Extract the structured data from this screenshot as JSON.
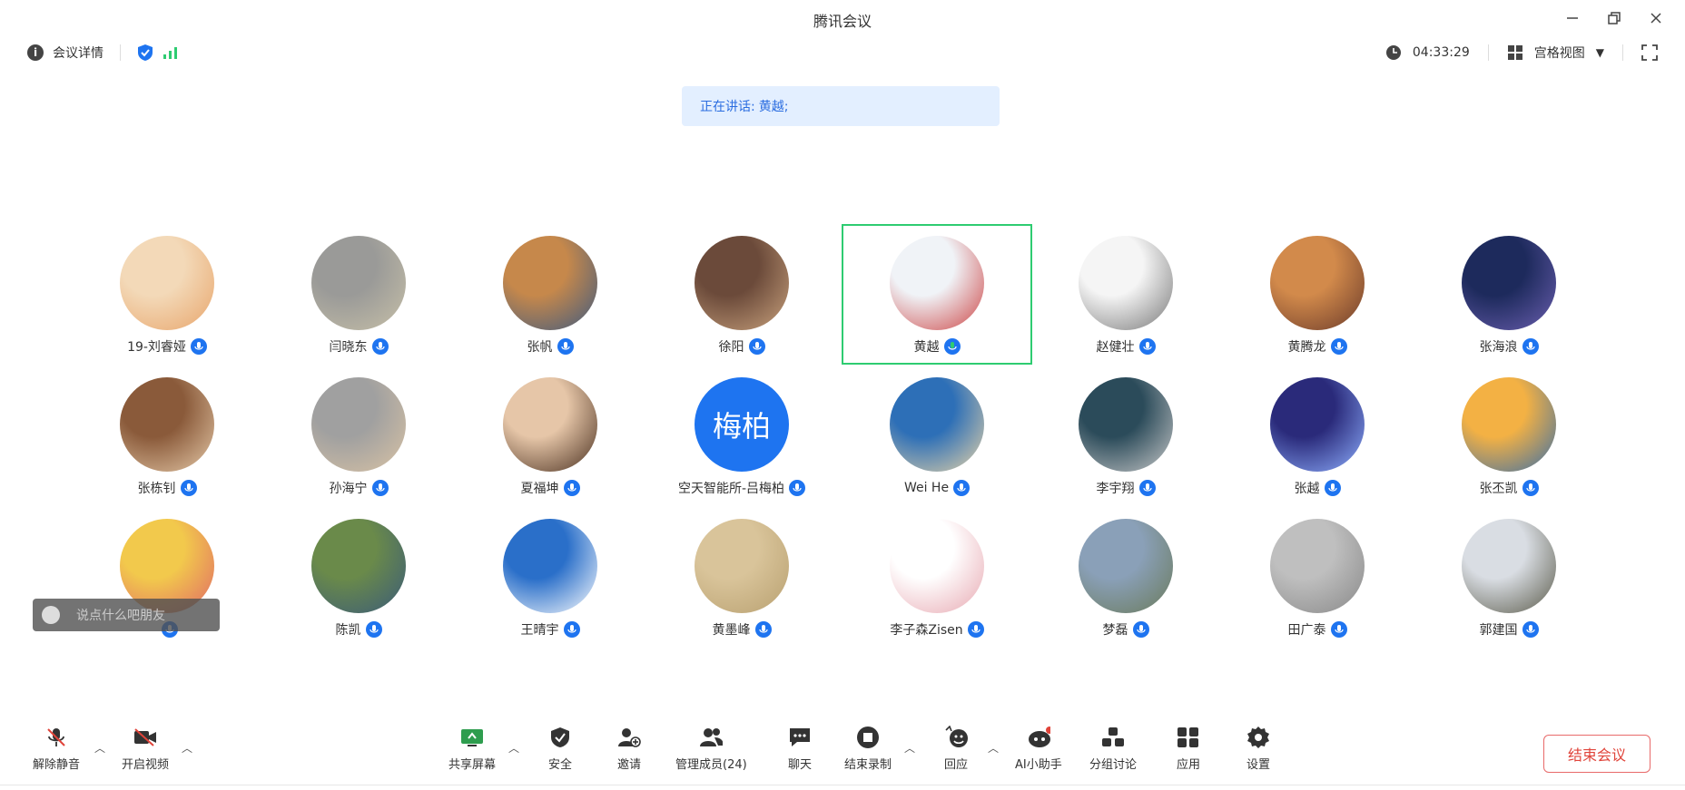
{
  "window": {
    "title": "腾讯会议"
  },
  "infobar": {
    "meeting_details": "会议详情",
    "timer": "04:33:29",
    "view_mode": "宫格视图"
  },
  "speaking": {
    "label": "正在讲话:",
    "name": "黄越;"
  },
  "participants": [
    {
      "name": "19-刘睿娅",
      "avatar": "photo"
    },
    {
      "name": "闫晓东",
      "avatar": "photo"
    },
    {
      "name": "张帆",
      "avatar": "photo"
    },
    {
      "name": "徐阳",
      "avatar": "photo"
    },
    {
      "name": "黄越",
      "avatar": "photo",
      "speaking": true
    },
    {
      "name": "赵健壮",
      "avatar": "photo"
    },
    {
      "name": "黄腾龙",
      "avatar": "photo"
    },
    {
      "name": "张海浪",
      "avatar": "photo"
    },
    {
      "name": "张栋钊",
      "avatar": "photo"
    },
    {
      "name": "孙海宁",
      "avatar": "photo"
    },
    {
      "name": "夏福坤",
      "avatar": "photo"
    },
    {
      "name": "空天智能所-吕梅柏",
      "avatar": "text",
      "avatar_text": "梅柏"
    },
    {
      "name": "Wei He",
      "avatar": "photo"
    },
    {
      "name": "李宇翔",
      "avatar": "photo"
    },
    {
      "name": "张越",
      "avatar": "photo"
    },
    {
      "name": "张丕凯",
      "avatar": "photo"
    },
    {
      "name": "",
      "avatar": "photo"
    },
    {
      "name": "陈凯",
      "avatar": "photo"
    },
    {
      "name": "王晴宇",
      "avatar": "photo"
    },
    {
      "name": "黄墨峰",
      "avatar": "photo"
    },
    {
      "name": "李子森Zisen",
      "avatar": "photo"
    },
    {
      "name": "梦磊",
      "avatar": "photo"
    },
    {
      "name": "田广泰",
      "avatar": "photo"
    },
    {
      "name": "郭建国",
      "avatar": "photo"
    }
  ],
  "chat": {
    "placeholder": "说点什么吧朋友"
  },
  "toolbar": {
    "unmute": "解除静音",
    "start_video": "开启视频",
    "share_screen": "共享屏幕",
    "security": "安全",
    "invite": "邀请",
    "manage_members": "管理成员(24)",
    "chat": "聊天",
    "end_recording": "结束录制",
    "reactions": "回应",
    "ai_assistant": "AI小助手",
    "breakout": "分组讨论",
    "apps": "应用",
    "settings": "设置",
    "end_meeting": "结束会议"
  },
  "colors": {
    "accent": "#1e74f0",
    "speaking_border": "#2ecc71",
    "end_red": "#e0443a",
    "speaking_bg": "#e3efff"
  }
}
